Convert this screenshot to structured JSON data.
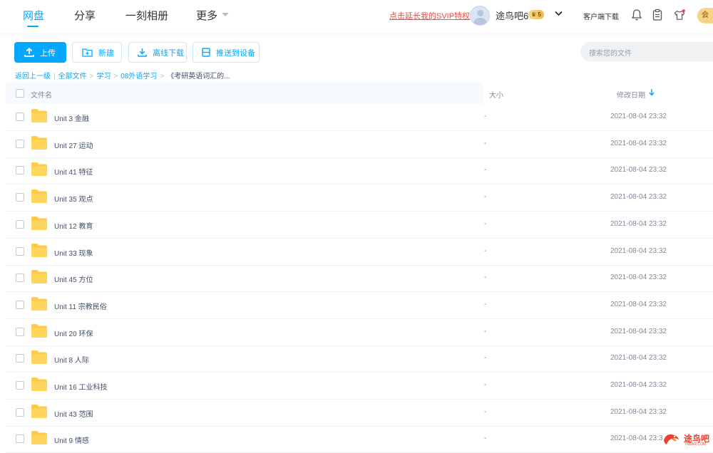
{
  "nav": {
    "tabs": [
      {
        "label": "网盘"
      },
      {
        "label": "分享"
      },
      {
        "label": "一刻相册"
      },
      {
        "label": "更多"
      }
    ]
  },
  "header": {
    "svip_link": "点击延长我的SVIP特权",
    "username": "途鸟吧6",
    "vip_level": "5",
    "client_download": "客户端下载",
    "coin_label": "会"
  },
  "toolbar": {
    "upload_label": "上传",
    "new_label": "新建",
    "offline_label": "离线下载",
    "push_label": "推送到设备",
    "search_placeholder": "搜索您的文件"
  },
  "breadcrumb": {
    "back": "返回上一级",
    "items": [
      "全部文件",
      "学习",
      "08外语学习"
    ],
    "current": "《考研英语词汇的..."
  },
  "table": {
    "headers": {
      "name": "文件名",
      "size": "大小",
      "modified": "修改日期"
    },
    "rows": [
      {
        "name": "Unit 3 金融",
        "size": "-",
        "modified": "2021-08-04 23:32"
      },
      {
        "name": "Unit 27 运动",
        "size": "-",
        "modified": "2021-08-04 23:32"
      },
      {
        "name": "Unit 41 特征",
        "size": "-",
        "modified": "2021-08-04 23:32"
      },
      {
        "name": "Unit 35 观点",
        "size": "-",
        "modified": "2021-08-04 23:32"
      },
      {
        "name": "Unit 12 教育",
        "size": "-",
        "modified": "2021-08-04 23:32"
      },
      {
        "name": "Unit 33 现象",
        "size": "-",
        "modified": "2021-08-04 23:32"
      },
      {
        "name": "Unit 45 方位",
        "size": "-",
        "modified": "2021-08-04 23:32"
      },
      {
        "name": "Unit 11 宗教民俗",
        "size": "-",
        "modified": "2021-08-04 23:32"
      },
      {
        "name": "Unit 20 环保",
        "size": "-",
        "modified": "2021-08-04 23:32"
      },
      {
        "name": "Unit 8 人际",
        "size": "-",
        "modified": "2021-08-04 23:32"
      },
      {
        "name": "Unit 16 工业科技",
        "size": "-",
        "modified": "2021-08-04 23:32"
      },
      {
        "name": "Unit 43 范围",
        "size": "-",
        "modified": "2021-08-04 23:32"
      },
      {
        "name": "Unit 9 情感",
        "size": "-",
        "modified": "2021-08-04 23:3"
      }
    ]
  },
  "watermark": {
    "text": "途鸟吧",
    "sub": "TNBAR.COM"
  },
  "colors": {
    "accent": "#06a7ff",
    "svip_link": "#f5483c",
    "folder": "#ffcb45"
  }
}
